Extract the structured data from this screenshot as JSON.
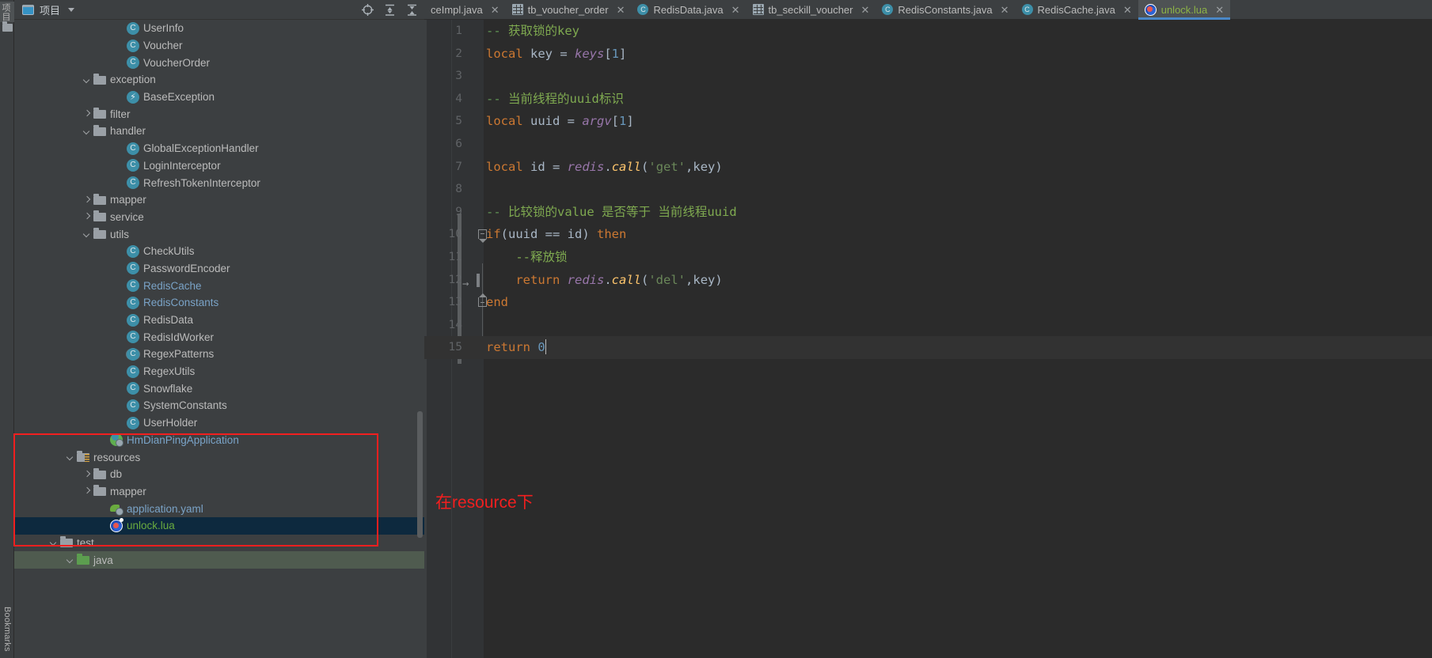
{
  "window": {
    "left_strip": {
      "project_tab": "项目",
      "bookmarks_tab": "Bookmarks"
    }
  },
  "project_panel": {
    "title": "项目",
    "icon": "project-window-icon",
    "toolbar": [
      {
        "name": "select-opened-file-icon",
        "label": "⌖"
      },
      {
        "name": "expand-all-icon",
        "label": "≛"
      },
      {
        "name": "collapse-all-icon",
        "label": "≛"
      },
      {
        "name": "settings-gear-icon",
        "label": "⚙"
      },
      {
        "name": "hide-icon",
        "label": "—"
      }
    ],
    "tree": [
      {
        "label": "UserInfo",
        "icon": "class-icon",
        "indent": 7,
        "arrow": "none",
        "style": "normal"
      },
      {
        "label": "Voucher",
        "icon": "class-icon",
        "indent": 7,
        "arrow": "none",
        "style": "normal"
      },
      {
        "label": "VoucherOrder",
        "icon": "class-icon",
        "indent": 7,
        "arrow": "none",
        "style": "normal"
      },
      {
        "label": "exception",
        "icon": "folder-icon",
        "indent": 5,
        "arrow": "down",
        "style": "normal"
      },
      {
        "label": "BaseException",
        "icon": "exception-icon",
        "indent": 7,
        "arrow": "none",
        "style": "normal"
      },
      {
        "label": "filter",
        "icon": "folder-icon",
        "indent": 5,
        "arrow": "right",
        "style": "normal"
      },
      {
        "label": "handler",
        "icon": "folder-icon",
        "indent": 5,
        "arrow": "down",
        "style": "normal"
      },
      {
        "label": "GlobalExceptionHandler",
        "icon": "class-icon",
        "indent": 7,
        "arrow": "none",
        "style": "normal"
      },
      {
        "label": "LoginInterceptor",
        "icon": "class-icon",
        "indent": 7,
        "arrow": "none",
        "style": "normal"
      },
      {
        "label": "RefreshTokenInterceptor",
        "icon": "class-icon",
        "indent": 7,
        "arrow": "none",
        "style": "normal"
      },
      {
        "label": "mapper",
        "icon": "folder-icon",
        "indent": 5,
        "arrow": "right",
        "style": "normal"
      },
      {
        "label": "service",
        "icon": "folder-icon",
        "indent": 5,
        "arrow": "right",
        "style": "normal"
      },
      {
        "label": "utils",
        "icon": "folder-icon",
        "indent": 5,
        "arrow": "down",
        "style": "normal"
      },
      {
        "label": "CheckUtils",
        "icon": "class-icon",
        "indent": 7,
        "arrow": "none",
        "style": "normal"
      },
      {
        "label": "PasswordEncoder",
        "icon": "class-icon",
        "indent": 7,
        "arrow": "none",
        "style": "normal"
      },
      {
        "label": "RedisCache",
        "icon": "class-icon",
        "indent": 7,
        "arrow": "none",
        "style": "open"
      },
      {
        "label": "RedisConstants",
        "icon": "class-icon",
        "indent": 7,
        "arrow": "none",
        "style": "open"
      },
      {
        "label": "RedisData",
        "icon": "class-icon",
        "indent": 7,
        "arrow": "none",
        "style": "normal"
      },
      {
        "label": "RedisIdWorker",
        "icon": "class-icon",
        "indent": 7,
        "arrow": "none",
        "style": "normal"
      },
      {
        "label": "RegexPatterns",
        "icon": "interface-icon",
        "indent": 7,
        "arrow": "none",
        "style": "normal"
      },
      {
        "label": "RegexUtils",
        "icon": "class-icon",
        "indent": 7,
        "arrow": "none",
        "style": "normal"
      },
      {
        "label": "Snowflake",
        "icon": "class-icon",
        "indent": 7,
        "arrow": "none",
        "style": "normal"
      },
      {
        "label": "SystemConstants",
        "icon": "class-icon",
        "indent": 7,
        "arrow": "none",
        "style": "normal"
      },
      {
        "label": "UserHolder",
        "icon": "class-icon",
        "indent": 7,
        "arrow": "none",
        "style": "normal"
      },
      {
        "label": "HmDianPingApplication",
        "icon": "spring-boot-icon",
        "indent": 6,
        "arrow": "none",
        "style": "open"
      },
      {
        "label": "resources",
        "icon": "resources-folder-icon",
        "indent": 4,
        "arrow": "down",
        "style": "normal"
      },
      {
        "label": "db",
        "icon": "folder-icon",
        "indent": 5,
        "arrow": "right",
        "style": "normal"
      },
      {
        "label": "mapper",
        "icon": "folder-icon",
        "indent": 5,
        "arrow": "right",
        "style": "normal"
      },
      {
        "label": "application.yaml",
        "icon": "yaml-icon",
        "indent": 6,
        "arrow": "none",
        "style": "open"
      },
      {
        "label": "unlock.lua",
        "icon": "lua-icon",
        "indent": 6,
        "arrow": "none",
        "style": "selected"
      },
      {
        "label": "test",
        "icon": "folder-icon",
        "indent": 3,
        "arrow": "down",
        "style": "normal"
      },
      {
        "label": "java",
        "icon": "test-source-folder-icon",
        "indent": 4,
        "arrow": "down",
        "style": "testroot"
      }
    ]
  },
  "editor": {
    "tabs": [
      {
        "label": "ceImpl.java",
        "icon": "java-class-icon",
        "active": false,
        "truncated": true
      },
      {
        "label": "tb_voucher_order",
        "icon": "database-table-icon",
        "active": false
      },
      {
        "label": "RedisData.java",
        "icon": "java-class-icon",
        "active": false
      },
      {
        "label": "tb_seckill_voucher",
        "icon": "database-table-icon",
        "active": false
      },
      {
        "label": "RedisConstants.java",
        "icon": "java-class-icon",
        "active": false
      },
      {
        "label": "RedisCache.java",
        "icon": "java-class-icon",
        "active": false
      },
      {
        "label": "unlock.lua",
        "icon": "lua-icon",
        "active": true
      }
    ],
    "close_glyph": "✕",
    "lines": [
      {
        "num": "1",
        "tokens": [
          {
            "t": "-- ",
            "c": "t-cmt"
          },
          {
            "t": "获取锁的key",
            "c": "t-cmt-cjk"
          }
        ]
      },
      {
        "num": "2",
        "tokens": [
          {
            "t": "local ",
            "c": "t-kw"
          },
          {
            "t": "key ",
            "c": "t-var"
          },
          {
            "t": "= ",
            "c": "t-punc"
          },
          {
            "t": "keys",
            "c": "t-glob"
          },
          {
            "t": "[",
            "c": "t-punc"
          },
          {
            "t": "1",
            "c": "t-num"
          },
          {
            "t": "]",
            "c": "t-punc"
          }
        ]
      },
      {
        "num": "3",
        "tokens": []
      },
      {
        "num": "4",
        "tokens": [
          {
            "t": "-- ",
            "c": "t-cmt"
          },
          {
            "t": "当前线程的uuid标识",
            "c": "t-cmt-cjk"
          }
        ]
      },
      {
        "num": "5",
        "tokens": [
          {
            "t": "local ",
            "c": "t-kw"
          },
          {
            "t": "uuid ",
            "c": "t-var"
          },
          {
            "t": "= ",
            "c": "t-punc"
          },
          {
            "t": "argv",
            "c": "t-glob"
          },
          {
            "t": "[",
            "c": "t-punc"
          },
          {
            "t": "1",
            "c": "t-num"
          },
          {
            "t": "]",
            "c": "t-punc"
          }
        ]
      },
      {
        "num": "6",
        "tokens": []
      },
      {
        "num": "7",
        "tokens": [
          {
            "t": "local ",
            "c": "t-kw"
          },
          {
            "t": "id ",
            "c": "t-var"
          },
          {
            "t": "= ",
            "c": "t-punc"
          },
          {
            "t": "redis",
            "c": "t-glob"
          },
          {
            "t": ".",
            "c": "t-punc"
          },
          {
            "t": "call",
            "c": "t-fn"
          },
          {
            "t": "(",
            "c": "t-punc"
          },
          {
            "t": "'get'",
            "c": "t-str"
          },
          {
            "t": ",",
            "c": "t-punc"
          },
          {
            "t": "key",
            "c": "t-var"
          },
          {
            "t": ")",
            "c": "t-punc"
          }
        ]
      },
      {
        "num": "8",
        "tokens": []
      },
      {
        "num": "9",
        "tokens": [
          {
            "t": "-- ",
            "c": "t-cmt"
          },
          {
            "t": "比较锁的value 是否等于 当前线程uuid",
            "c": "t-cmt-cjk"
          }
        ]
      },
      {
        "num": "10",
        "tokens": [
          {
            "t": "if",
            "c": "t-kw"
          },
          {
            "t": "(",
            "c": "t-punc"
          },
          {
            "t": "uuid == id",
            "c": "t-var"
          },
          {
            "t": ") ",
            "c": "t-punc"
          },
          {
            "t": "then",
            "c": "t-kw"
          }
        ],
        "fold": "open"
      },
      {
        "num": "11",
        "tokens": [
          {
            "t": "    --释放锁",
            "c": "t-cmt-cjk"
          }
        ]
      },
      {
        "num": "12",
        "tokens": [
          {
            "t": "    ",
            "c": "t-punc"
          },
          {
            "t": "return ",
            "c": "t-kw"
          },
          {
            "t": "redis",
            "c": "t-glob"
          },
          {
            "t": ".",
            "c": "t-punc"
          },
          {
            "t": "call",
            "c": "t-fn"
          },
          {
            "t": "(",
            "c": "t-punc"
          },
          {
            "t": "'del'",
            "c": "t-str"
          },
          {
            "t": ",",
            "c": "t-punc"
          },
          {
            "t": "key",
            "c": "t-var"
          },
          {
            "t": ")",
            "c": "t-punc"
          }
        ],
        "tab_marker": "→"
      },
      {
        "num": "13",
        "tokens": [
          {
            "t": "end",
            "c": "t-kw"
          }
        ],
        "fold": "close"
      },
      {
        "num": "14",
        "tokens": []
      },
      {
        "num": "15",
        "tokens": [
          {
            "t": "return ",
            "c": "t-kw"
          },
          {
            "t": "0",
            "c": "t-num"
          }
        ],
        "caret": true
      }
    ],
    "annotation": "在resource下"
  },
  "colors": {
    "accent_blue": "#4a88c7",
    "annotation_red": "#f21f1f",
    "selection_blue": "#0d293e",
    "editor_bg": "#2b2b2b",
    "panel_bg": "#3c3f41"
  }
}
